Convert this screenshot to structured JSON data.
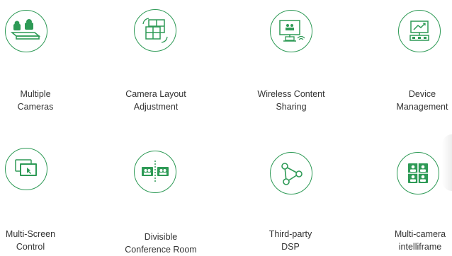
{
  "features": [
    {
      "label_line1": "Multiple",
      "label_line2": "Cameras",
      "icon": "multiple-cameras-icon"
    },
    {
      "label_line1": "Camera Layout",
      "label_line2": "Adjustment",
      "icon": "camera-layout-icon"
    },
    {
      "label_line1": "Wireless Content",
      "label_line2": "Sharing",
      "icon": "wireless-sharing-icon"
    },
    {
      "label_line1": "Device",
      "label_line2": "Management",
      "icon": "device-management-icon"
    },
    {
      "label_line1": "Multi-Screen",
      "label_line2": "Control",
      "icon": "multi-screen-icon"
    },
    {
      "label_line1": "Divisible",
      "label_line2": "Conference Room",
      "icon": "divisible-room-icon"
    },
    {
      "label_line1": "Third-party",
      "label_line2": "DSP",
      "icon": "third-party-dsp-icon"
    },
    {
      "label_line1": "Multi-camera",
      "label_line2": "intelliframe",
      "icon": "intelliframe-icon"
    }
  ],
  "colors": {
    "accent": "#2e9a56",
    "text": "#333333"
  }
}
